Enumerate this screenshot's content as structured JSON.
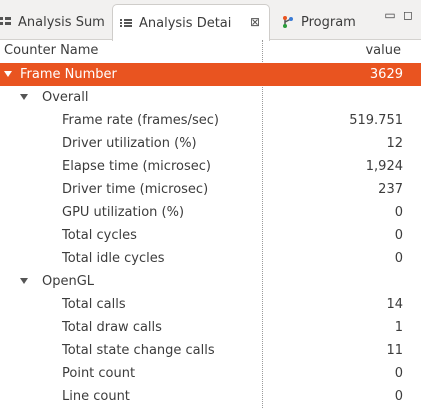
{
  "tabs": [
    {
      "label": "Analysis Sum",
      "icon": "grid-icon"
    },
    {
      "label": "Analysis Detai",
      "icon": "list-icon",
      "close_glyph": "⊠"
    },
    {
      "label": "Program",
      "icon": "branch-icon"
    }
  ],
  "window_controls": {
    "minimize": "▭",
    "maximize": "◻"
  },
  "columns": {
    "name": "Counter Name",
    "value": "value"
  },
  "rows": [
    {
      "name": "Frame Number",
      "value": "3629",
      "level": 0,
      "expanded": true,
      "selected": true
    },
    {
      "name": "Overall",
      "value": "",
      "level": 1,
      "expanded": true
    },
    {
      "name": "Frame rate (frames/sec)",
      "value": "519.751",
      "level": 2
    },
    {
      "name": "Driver utilization (%)",
      "value": "12",
      "level": 2
    },
    {
      "name": "Elapse time (microsec)",
      "value": "1,924",
      "level": 2
    },
    {
      "name": "Driver time (microsec)",
      "value": "237",
      "level": 2
    },
    {
      "name": "GPU utilization (%)",
      "value": "0",
      "level": 2
    },
    {
      "name": "Total cycles",
      "value": "0",
      "level": 2
    },
    {
      "name": "Total idle cycles",
      "value": "0",
      "level": 2
    },
    {
      "name": "OpenGL",
      "value": "",
      "level": 1,
      "expanded": true
    },
    {
      "name": "Total calls",
      "value": "14",
      "level": 2
    },
    {
      "name": "Total draw calls",
      "value": "1",
      "level": 2
    },
    {
      "name": "Total state change calls",
      "value": "11",
      "level": 2
    },
    {
      "name": "Point count",
      "value": "0",
      "level": 2
    },
    {
      "name": "Line count",
      "value": "0",
      "level": 2
    }
  ],
  "colors": {
    "selection": "#e95420",
    "tab_bar": "#f2f1f0"
  }
}
